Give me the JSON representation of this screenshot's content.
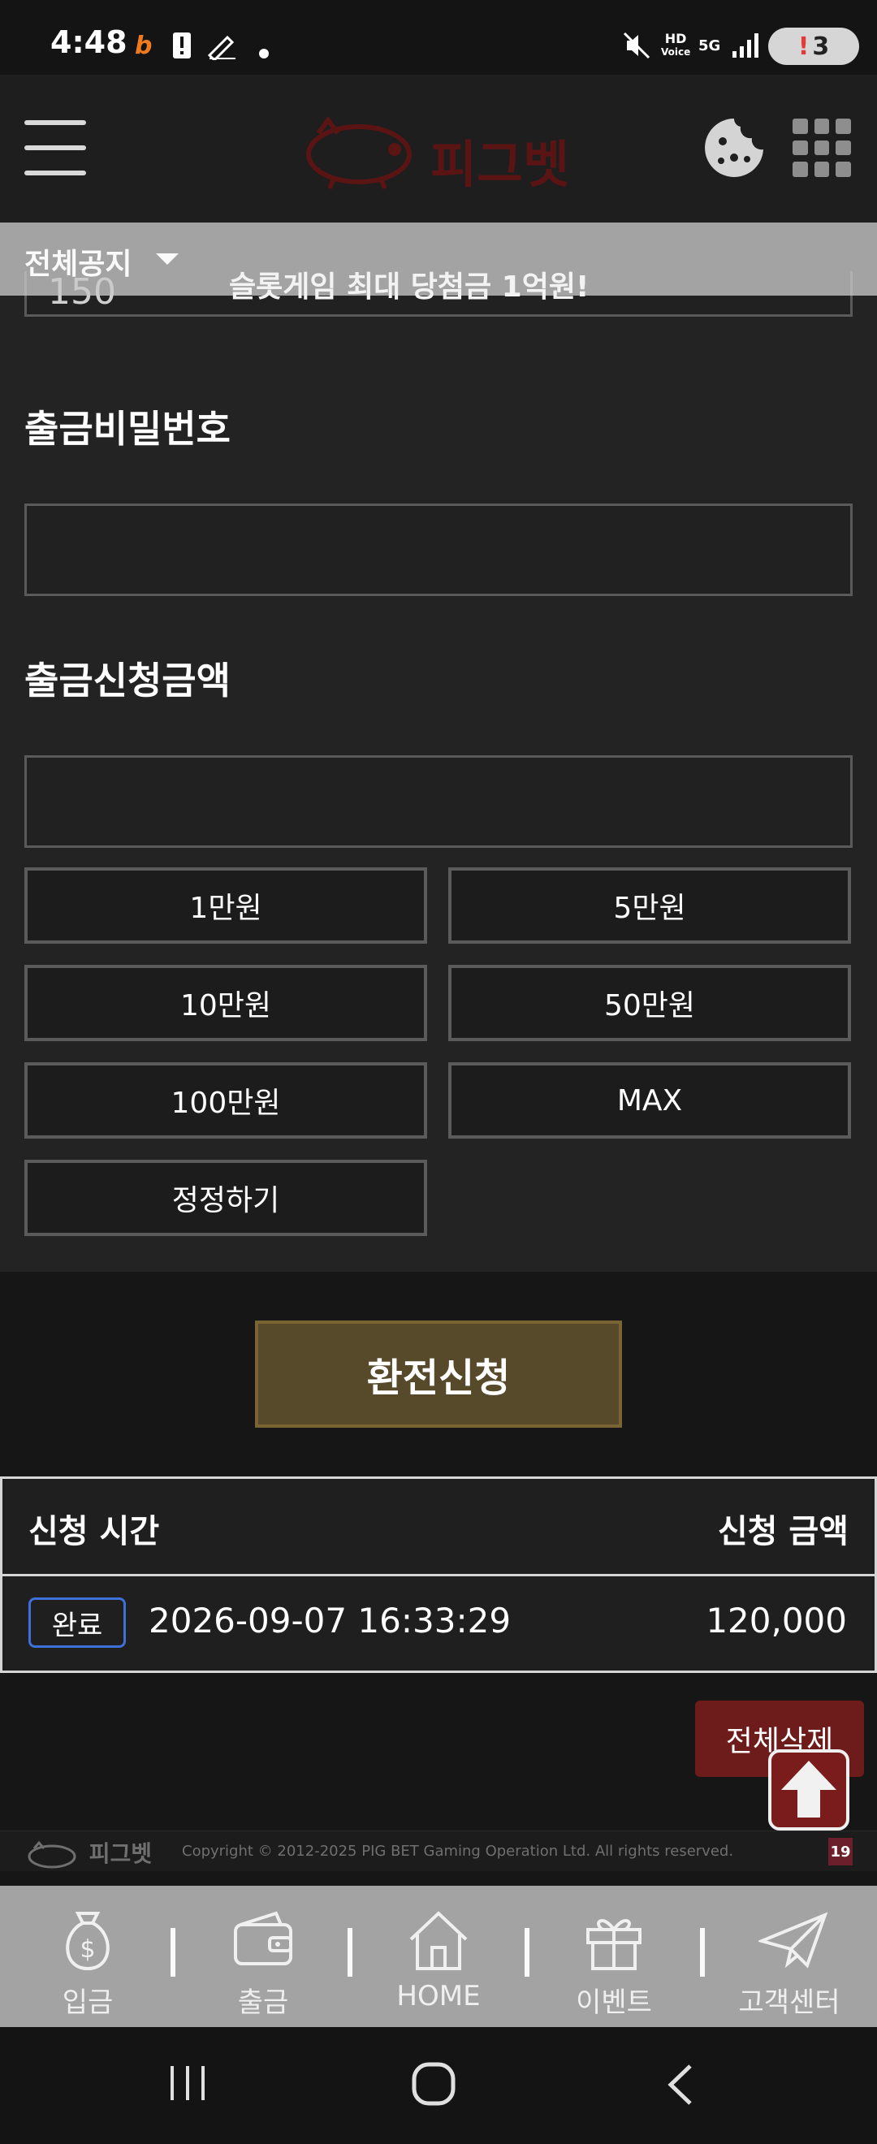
{
  "status_bar": {
    "time": "4:48",
    "battery_level": "3"
  },
  "header": {
    "logo_text": "피그벳"
  },
  "notice": {
    "label": "전체공지",
    "text": "슬롯게임 최대 당첨금 1억원!"
  },
  "form": {
    "partial_value": "150",
    "password_label": "출금비밀번호",
    "password_value": "",
    "amount_label": "출금신청금액",
    "amount_value": "",
    "amount_buttons": [
      "1만원",
      "5만원",
      "10만원",
      "50만원",
      "100만원",
      "MAX",
      "정정하기"
    ]
  },
  "apply_button": "환전신청",
  "history": {
    "col_time": "신청 시간",
    "col_amount": "신청 금액",
    "rows": [
      {
        "status": "완료",
        "time": "2026-09-07 16:33:29",
        "amount": "120,000"
      }
    ]
  },
  "delete_all_button": "전체삭제",
  "footer": {
    "logo_text": "피그벳",
    "copyright": "Copyright © 2012-2025 PIG BET Gaming Operation Ltd. All rights reserved.",
    "age_badge": "19"
  },
  "bottom_nav": [
    {
      "label": "입금",
      "icon": "money-bag-icon"
    },
    {
      "label": "출금",
      "icon": "wallet-icon"
    },
    {
      "label": "HOME",
      "icon": "home-icon"
    },
    {
      "label": "이벤트",
      "icon": "gift-icon"
    },
    {
      "label": "고객센터",
      "icon": "paper-plane-icon"
    }
  ],
  "colors": {
    "apply_button_bg": "#574a2b",
    "delete_button_bg": "#6e1b1b",
    "logo_red": "#5a1414",
    "badge_border": "#3f6fd8"
  }
}
